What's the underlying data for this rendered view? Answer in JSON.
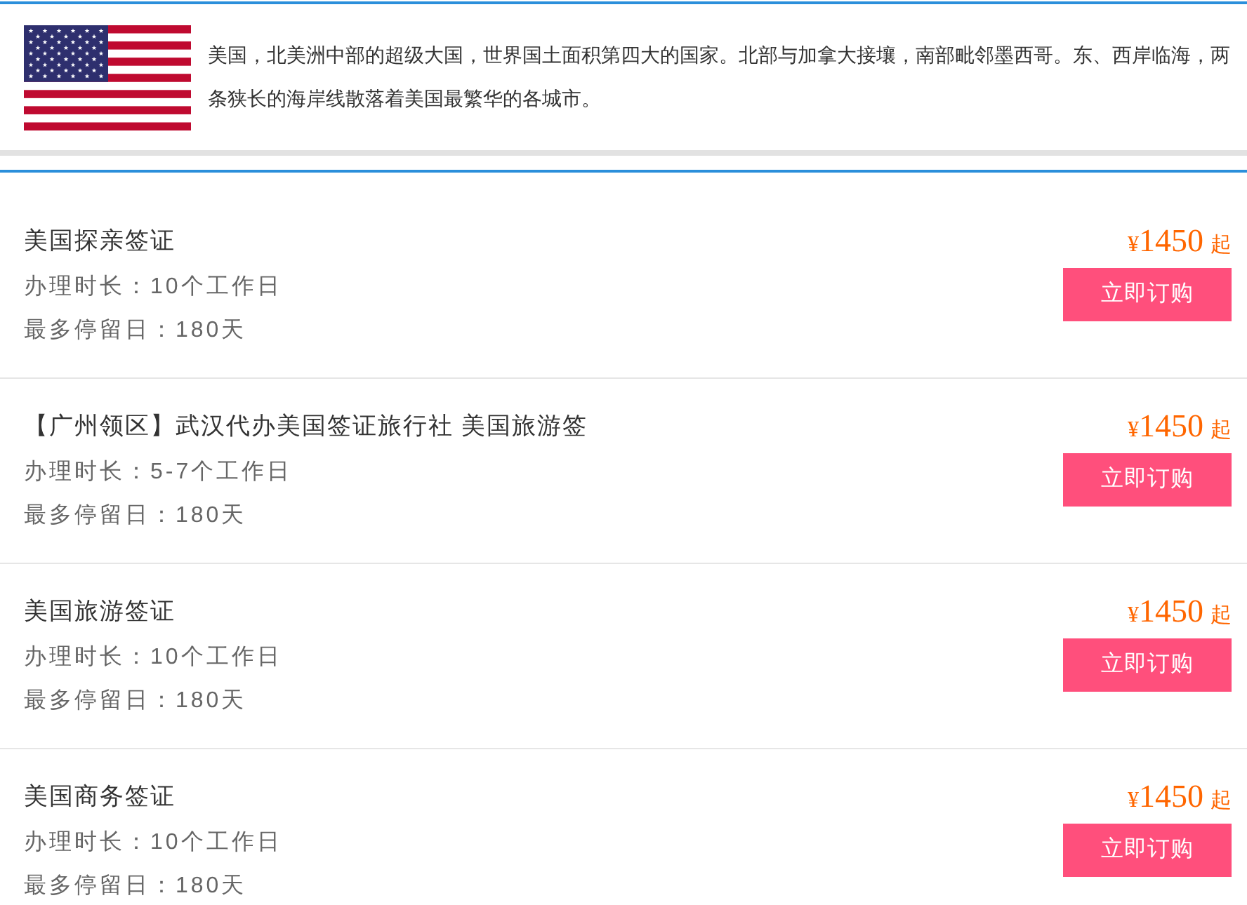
{
  "intro": {
    "text": "美国，北美洲中部的超级大国，世界国土面积第四大的国家。北部与加拿大接壤，南部毗邻墨西哥。东、西岸临海，两条狭长的海岸线散落着美国最繁华的各城市。"
  },
  "products": [
    {
      "title": "美国探亲签证",
      "details": [
        "办理时长：10个工作日",
        "最多停留日：180天"
      ],
      "price": {
        "currency": "¥",
        "amount": "1450",
        "suffix": "起"
      },
      "button": "立即订购"
    },
    {
      "title": "【广州领区】武汉代办美国签证旅行社 美国旅游签",
      "details": [
        "办理时长：5-7个工作日",
        "最多停留日：180天"
      ],
      "price": {
        "currency": "¥",
        "amount": "1450",
        "suffix": "起"
      },
      "button": "立即订购"
    },
    {
      "title": "美国旅游签证",
      "details": [
        "办理时长：10个工作日",
        "最多停留日：180天"
      ],
      "price": {
        "currency": "¥",
        "amount": "1450",
        "suffix": "起"
      },
      "button": "立即订购"
    },
    {
      "title": "美国商务签证",
      "details": [
        "办理时长：10个工作日",
        "最多停留日：180天"
      ],
      "price": {
        "currency": "¥",
        "amount": "1450",
        "suffix": "起"
      },
      "button": "立即订购"
    }
  ]
}
